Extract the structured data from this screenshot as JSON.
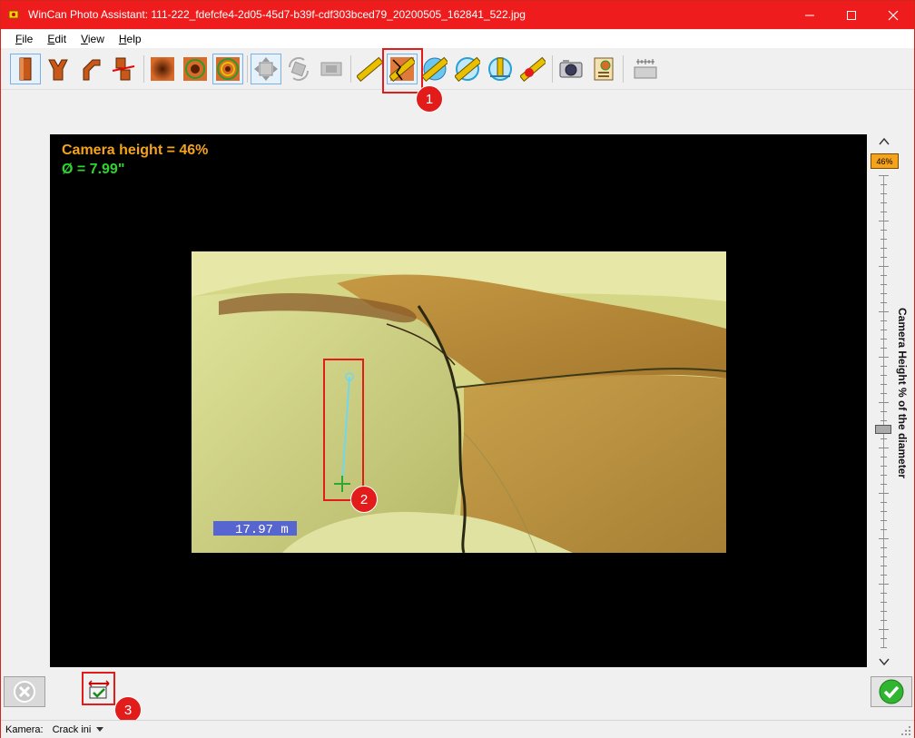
{
  "window": {
    "title": "WinCan Photo Assistant: 111-222_fdefcfe4-2d05-45d7-b39f-cdf303bced79_20200505_162841_522.jpg",
    "accent": "#ee1c1c"
  },
  "menu": [
    {
      "label": "File",
      "u": "F",
      "rest": "ile"
    },
    {
      "label": "Edit",
      "u": "E",
      "rest": "dit"
    },
    {
      "label": "View",
      "u": "V",
      "rest": "iew"
    },
    {
      "label": "Help",
      "u": "H",
      "rest": "elp"
    }
  ],
  "toolbar": {
    "tools": [
      {
        "name": "straight-pipe-icon",
        "selected": true
      },
      {
        "name": "y-junction-icon",
        "selected": false
      },
      {
        "name": "bend-pipe-icon",
        "selected": false
      },
      {
        "name": "offset-joint-icon",
        "selected": false
      },
      {
        "name": "radial-gradient-icon",
        "selected": false
      },
      {
        "name": "ring-target-icon",
        "selected": false
      },
      {
        "name": "double-ring-target-icon",
        "selected": true
      },
      {
        "name": "move-arrows-icon",
        "selected": true
      },
      {
        "name": "rotate-icon",
        "selected": false
      },
      {
        "name": "fit-image-icon",
        "selected": false
      },
      {
        "name": "ruler-icon",
        "selected": false
      },
      {
        "name": "crack-width-measure-icon",
        "selected": true
      },
      {
        "name": "diameter-ruler-icon",
        "selected": false
      },
      {
        "name": "circle-ruler-icon",
        "selected": false
      },
      {
        "name": "angle-ruler-icon",
        "selected": false
      },
      {
        "name": "point-measure-icon",
        "selected": false
      },
      {
        "name": "camera-icon",
        "selected": false
      },
      {
        "name": "report-save-icon",
        "selected": false
      },
      {
        "name": "scale-icon",
        "selected": false
      }
    ]
  },
  "callouts": [
    "1",
    "2",
    "3"
  ],
  "viewer": {
    "camera_height": "Camera height = 46%",
    "diameter": "Ø = 7.99\"",
    "overlay_text": "17.97 m"
  },
  "slider": {
    "value_label": "46%",
    "value": 46,
    "axis_label": "Camera Height % of the diameter"
  },
  "status": {
    "camera_label": "Kamera:",
    "camera_value": "Crack ini"
  }
}
